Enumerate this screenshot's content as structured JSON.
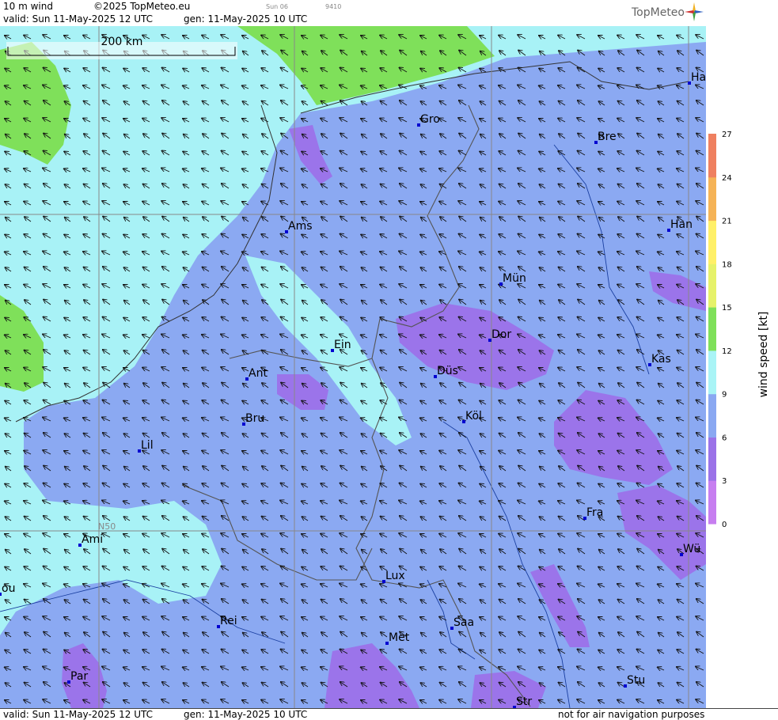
{
  "header": {
    "field": "10 m wind",
    "copyright": "©2025 TopMeteo.eu",
    "valid": "valid:  Sun  11-May-2025  12 UTC",
    "gen": "gen: 11-May-2025 10 UTC",
    "small_day": "Sun 06",
    "small_code": "9410",
    "brand": "TopMeteo"
  },
  "footer": {
    "valid": "valid:  Sun  11-May-2025  12 UTC",
    "gen": "gen: 11-May-2025 10 UTC",
    "disclaimer": "not for air navigation purposes"
  },
  "map": {
    "scale_label": "200 km",
    "lat_label": "N50",
    "wind_direction": "from south-east",
    "cities": [
      {
        "name": "Gro"
      },
      {
        "name": "Ha"
      },
      {
        "name": "Bre"
      },
      {
        "name": "Ams"
      },
      {
        "name": "Han"
      },
      {
        "name": "Mün"
      },
      {
        "name": "Ein"
      },
      {
        "name": "Dor"
      },
      {
        "name": "Kas"
      },
      {
        "name": "Ant"
      },
      {
        "name": "Düs"
      },
      {
        "name": "Bru"
      },
      {
        "name": "Köl"
      },
      {
        "name": "Lil"
      },
      {
        "name": "Fra"
      },
      {
        "name": "Ami"
      },
      {
        "name": "Wü"
      },
      {
        "name": "Lux"
      },
      {
        "name": "ou"
      },
      {
        "name": "Rei"
      },
      {
        "name": "Saa"
      },
      {
        "name": "Met"
      },
      {
        "name": "Par"
      },
      {
        "name": "Stu"
      },
      {
        "name": "Str"
      }
    ]
  },
  "legend": {
    "title": "wind  speed  [kt]",
    "ticks": [
      "27",
      "24",
      "21",
      "18",
      "15",
      "12",
      "9",
      "6",
      "3",
      "0"
    ],
    "colors": [
      "#c77ef0",
      "#9b72e8",
      "#8aa8f2",
      "#a9f4f6",
      "#7fe05a",
      "#e6f26a",
      "#fff068",
      "#f5b357",
      "#ef8060"
    ]
  }
}
